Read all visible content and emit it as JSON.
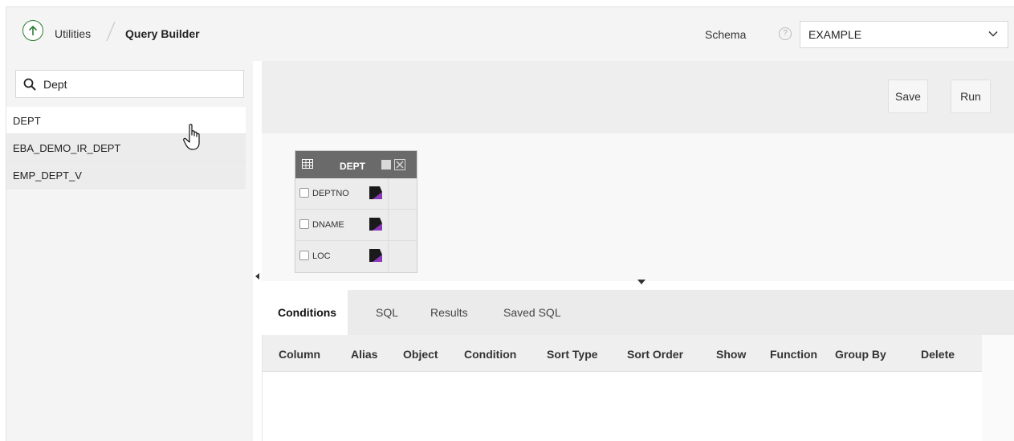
{
  "header": {
    "breadcrumb": [
      "Utilities",
      "Query Builder"
    ],
    "schema_label": "Schema",
    "schema_value": "EXAMPLE",
    "help_glyph": "?"
  },
  "search": {
    "value": "Dept"
  },
  "tables": [
    {
      "name": "DEPT",
      "selected": true
    },
    {
      "name": "EBA_DEMO_IR_DEPT",
      "selected": false
    },
    {
      "name": "EMP_DEPT_V",
      "selected": false
    }
  ],
  "toolbar": {
    "save_label": "Save",
    "run_label": "Run"
  },
  "dept_box": {
    "title": "DEPT",
    "columns": [
      "DEPTNO",
      "DNAME",
      "LOC"
    ]
  },
  "tabs": [
    "Conditions",
    "SQL",
    "Results",
    "Saved SQL"
  ],
  "conditions_columns": [
    "Column",
    "Alias",
    "Object",
    "Condition",
    "Sort Type",
    "Sort Order",
    "Show",
    "Function",
    "Group By",
    "Delete"
  ],
  "colors": {
    "accent": "#2e7d32",
    "header_bg": "#6a6a6a"
  }
}
